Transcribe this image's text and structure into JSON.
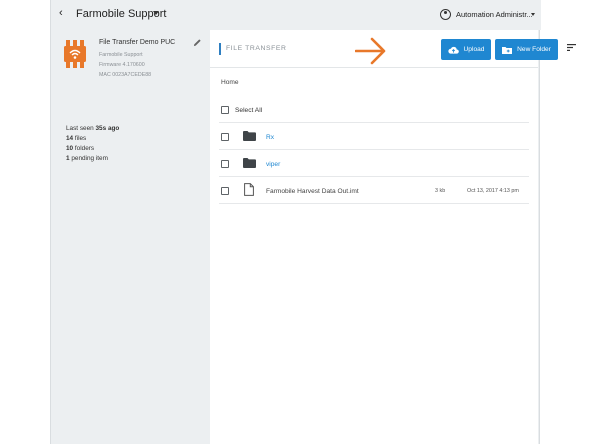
{
  "topbar": {
    "back_glyph": "‹",
    "org_name": "Farmobile Support",
    "user_name": "Automation Administr..."
  },
  "sidebar": {
    "device_name": "File Transfer Demo PUC",
    "device_org": "Farmobile Support",
    "firmware": "Firmware 4.170600",
    "mac": "MAC 0023A7CEDE88",
    "stats": {
      "last_seen_prefix": "Last seen",
      "last_seen_value": "35s ago",
      "files_count": "14",
      "files_label": "files",
      "folders_count": "10",
      "folders_label": "folders",
      "pending_count": "1",
      "pending_label": "pending item"
    }
  },
  "main": {
    "title": "FILE TRANSFER",
    "upload_label": "Upload",
    "new_folder_label": "New Folder",
    "breadcrumb": "Home",
    "select_all_label": "Select All",
    "items": [
      {
        "type": "folder",
        "name": "Rx",
        "size": "",
        "date": ""
      },
      {
        "type": "folder",
        "name": "viper",
        "size": "",
        "date": ""
      },
      {
        "type": "file",
        "name": "Farmobile Harvest Data Out.imt",
        "size": "3 kb",
        "date": "Oct 13, 2017 4:13 pm"
      }
    ]
  },
  "colors": {
    "accent": "#1f87d1",
    "device_orange": "#e8782a",
    "annotation_arrow": "#e8782a"
  }
}
